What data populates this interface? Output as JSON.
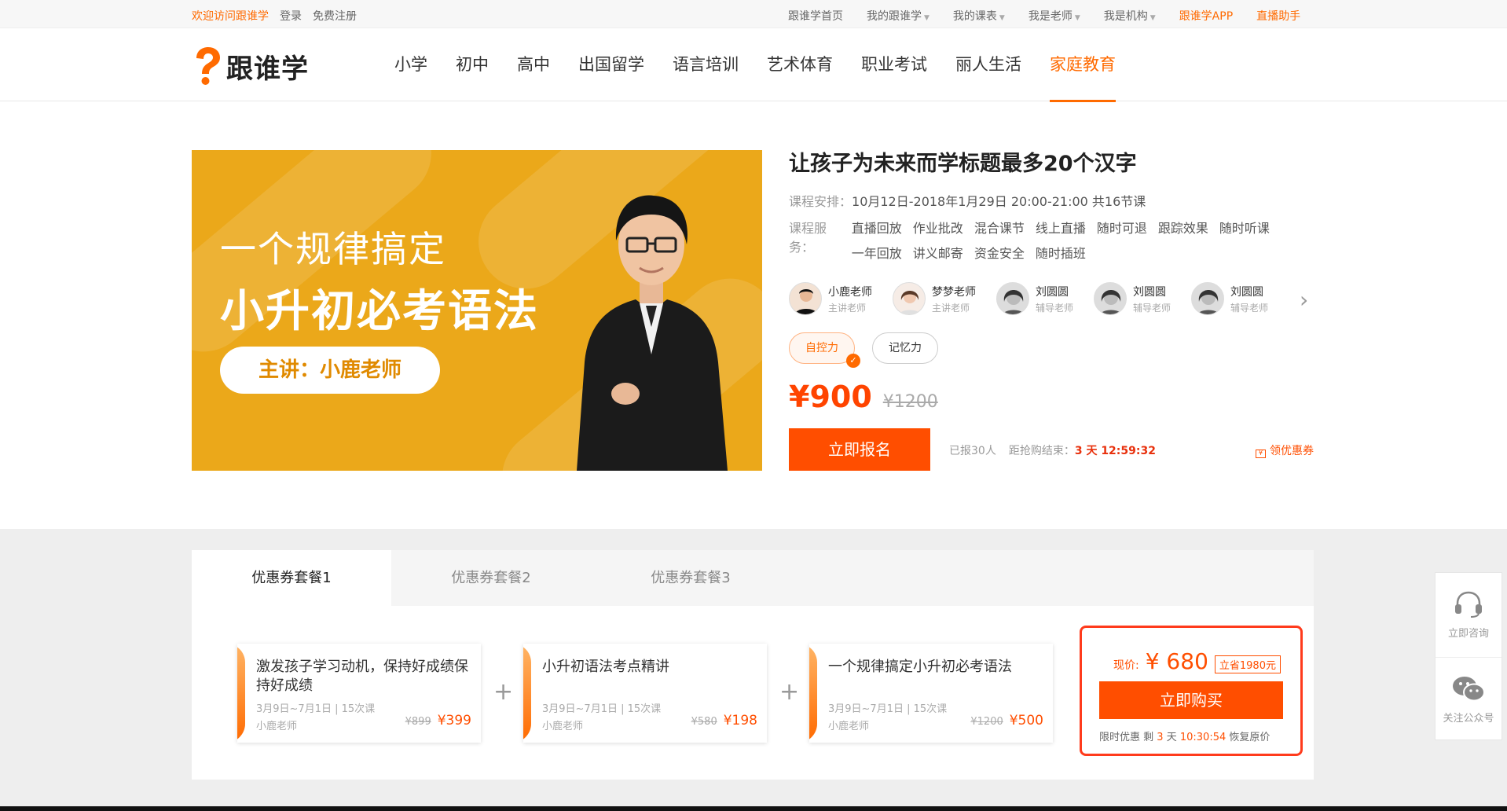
{
  "topbar": {
    "welcome": "欢迎访问跟谁学",
    "login": "登录",
    "register": "免费注册",
    "links": [
      "跟谁学首页",
      "我的跟谁学",
      "我的课表",
      "我是老师",
      "我是机构"
    ],
    "app": "跟谁学APP",
    "live_helper": "直播助手"
  },
  "logo": {
    "text": "跟谁学"
  },
  "nav": {
    "items": [
      "小学",
      "初中",
      "高中",
      "出国留学",
      "语言培训",
      "艺术体育",
      "职业考试",
      "丽人生活",
      "家庭教育"
    ],
    "active_index": 8
  },
  "banner": {
    "line1": "一个规律搞定",
    "line2": "小升初必考语法",
    "speaker": "主讲：小鹿老师"
  },
  "course": {
    "title": "让孩子为未来而学标题最多20个汉字",
    "schedule_label": "课程安排：",
    "schedule_value": "10月12日-2018年1月29日 20:00-21:00 共16节课",
    "services_label": "课程服务：",
    "services": [
      "直播回放",
      "作业批改",
      "混合课节",
      "线上直播",
      "随时可退",
      "跟踪效果",
      "随时听课",
      "一年回放",
      "讲义邮寄",
      "资金安全",
      "随时插班"
    ],
    "teachers": [
      {
        "name": "小鹿老师",
        "role": "主讲老师"
      },
      {
        "name": "梦梦老师",
        "role": "主讲老师"
      },
      {
        "name": "刘圆圆",
        "role": "辅导老师"
      },
      {
        "name": "刘圆圆",
        "role": "辅导老师"
      },
      {
        "name": "刘圆圆",
        "role": "辅导老师"
      }
    ],
    "tags": [
      "自控力",
      "记忆力"
    ],
    "price_now": "¥900",
    "price_old": "¥1200",
    "enroll_label": "立即报名",
    "sold": "已报30人",
    "countdown_label": "距抢购结束：",
    "countdown_value": "3 天 12:59:32",
    "coupon_link": "领优惠券"
  },
  "package_tabs": [
    "优惠券套餐1",
    "优惠券套餐2",
    "优惠券套餐3"
  ],
  "packages": [
    {
      "title": "激发孩子学习动机，保持好成绩保持好成绩",
      "dates": "3月9日~7月1日",
      "lessons": "15次课",
      "teacher": "小鹿老师",
      "old_price": "¥899",
      "new_price": "¥399"
    },
    {
      "title": "小升初语法考点精讲",
      "dates": "3月9日~7月1日",
      "lessons": "15次课",
      "teacher": "小鹿老师",
      "old_price": "¥580",
      "new_price": "¥198"
    },
    {
      "title": "一个规律搞定小升初必考语法",
      "dates": "3月9日~7月1日",
      "lessons": "15次课",
      "teacher": "小鹿老师",
      "old_price": "¥1200",
      "new_price": "¥500"
    }
  ],
  "buybox": {
    "label": "现价:",
    "price": "¥ 680",
    "save": "立省1980元",
    "button": "立即购买",
    "timer_prefix": "限时优惠 剩",
    "timer_days": "3",
    "timer_unit": "天",
    "timer_time": "10:30:54",
    "timer_suffix": "恢复原价"
  },
  "float": {
    "consult": "立即咨询",
    "follow": "关注公众号"
  },
  "colors": {
    "accent": "#ff6a00",
    "button": "#ff4e00",
    "banner": "#eba81a"
  }
}
